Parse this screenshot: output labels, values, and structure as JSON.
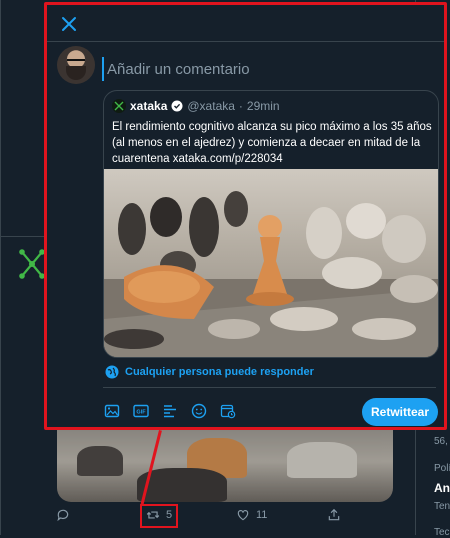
{
  "modal": {
    "composer_placeholder": "Añadir un comentario",
    "quoted_tweet": {
      "name": "xataka",
      "handle": "@xataka",
      "time": "29min",
      "text": "El rendimiento cognitivo alcanza su pico máximo a los 35 años (al menos en el ajedrez) y comienza a decaer en mitad de la cuarentena xataka.com/p/228034"
    },
    "reply_permission": "Cualquier persona puede responder",
    "retweet_button": "Retwittear",
    "icons": [
      "close-icon",
      "image-icon",
      "gif-icon",
      "poll-icon",
      "emoji-icon",
      "schedule-icon",
      "globe-icon",
      "verified-icon"
    ]
  },
  "background": {
    "retweet_count": "5",
    "like_count": "11",
    "side_snippets": {
      "a": "56,",
      "b": "Polí",
      "c": "An",
      "d": "Ten",
      "e": "Tec"
    }
  },
  "colors": {
    "accent": "#1da1f2",
    "background": "#15202b",
    "highlight": "#e0141e",
    "border": "#38444d"
  }
}
